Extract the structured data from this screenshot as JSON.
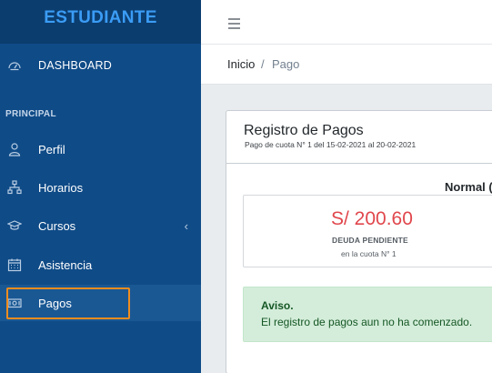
{
  "sidebar": {
    "brand": "ESTUDIANTE",
    "dashboard": {
      "label": "DASHBOARD",
      "icon": "speedometer-icon"
    },
    "section_title": "PRINCIPAL",
    "items": [
      {
        "label": "Perfil",
        "icon": "user-icon"
      },
      {
        "label": "Horarios",
        "icon": "sitemap-icon"
      },
      {
        "label": "Cursos",
        "icon": "graduation-cap-icon",
        "chevron": "‹"
      },
      {
        "label": "Asistencia",
        "icon": "calendar-icon"
      },
      {
        "label": "Pagos",
        "icon": "money-bill-icon"
      }
    ],
    "active_item": "Pagos",
    "highlight_color": "#f08c1e"
  },
  "header": {
    "menu_icon": "hamburger-icon"
  },
  "breadcrumb": {
    "home": "Inicio",
    "separator": "/",
    "current": "Pago"
  },
  "card": {
    "title": "Registro de Pagos",
    "subtitle": "Pago de cuota N° 1 del 15-02-2021 al 20-02-2021",
    "plan_label": "Normal (",
    "debt": {
      "amount": "S/ 200.60",
      "label": "DEUDA PENDIENTE",
      "note": "en la cuota N° 1",
      "color": "#e0474c"
    },
    "alert": {
      "title": "Aviso.",
      "text": "El registro de pagos aun no ha comenzado."
    }
  },
  "colors": {
    "sidebar_bg": "#0f4b87",
    "brand_text": "#3b9cf5",
    "alert_bg": "#d4edda"
  }
}
